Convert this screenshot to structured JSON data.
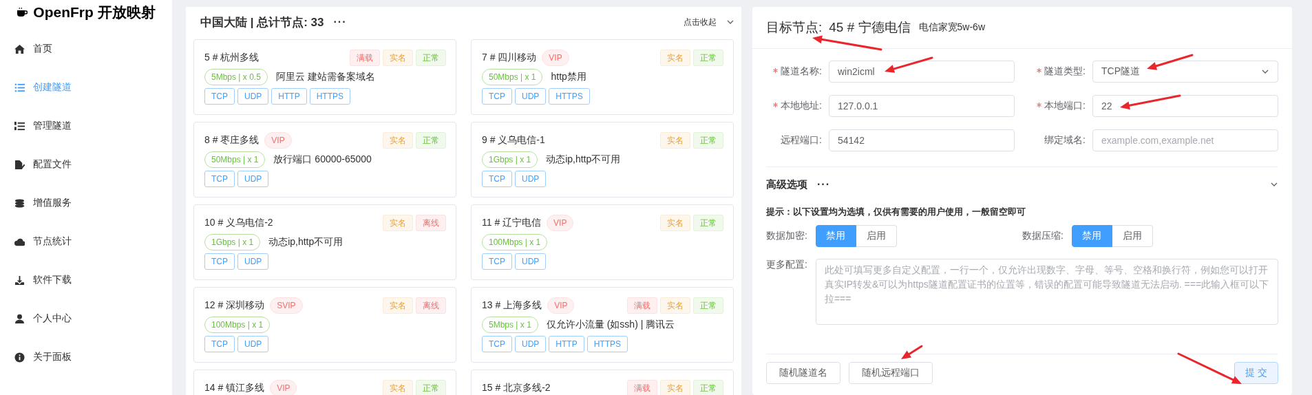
{
  "sidebar": {
    "logo": "OpenFrp 开放映射",
    "items": [
      {
        "label": "首页",
        "selected": false
      },
      {
        "label": "创建隧道",
        "selected": true
      },
      {
        "label": "管理隧道",
        "selected": false
      },
      {
        "label": "配置文件",
        "selected": false
      },
      {
        "label": "增值服务",
        "selected": false
      },
      {
        "label": "节点统计",
        "selected": false
      },
      {
        "label": "软件下载",
        "selected": false
      },
      {
        "label": "个人中心",
        "selected": false
      },
      {
        "label": "关于面板",
        "selected": false
      }
    ]
  },
  "node_panel": {
    "title": "中国大陆 | 总计节点: 33",
    "more": "···",
    "collapse": "点击收起",
    "nodes": [
      {
        "title": "5 # 杭州多线",
        "tags": [
          {
            "label": "满载",
            "kind": "danger"
          },
          {
            "label": "实名",
            "kind": "warning"
          },
          {
            "label": "正常",
            "kind": "success"
          }
        ],
        "speed": "5Mbps | x 0.5",
        "note": "阿里云 建站需备案域名",
        "protocols": [
          "TCP",
          "UDP",
          "HTTP",
          "HTTPS"
        ]
      },
      {
        "title": "7 # 四川移动",
        "level_badge": "VIP",
        "tags": [
          {
            "label": "实名",
            "kind": "warning"
          },
          {
            "label": "正常",
            "kind": "success"
          }
        ],
        "speed": "50Mbps | x 1",
        "note": "http禁用",
        "protocols": [
          "TCP",
          "UDP",
          "HTTPS"
        ]
      },
      {
        "title": "8 # 枣庄多线",
        "level_badge": "VIP",
        "tags": [
          {
            "label": "实名",
            "kind": "warning"
          },
          {
            "label": "正常",
            "kind": "success"
          }
        ],
        "speed": "50Mbps | x 1",
        "note": "放行端口 60000-65000",
        "protocols": [
          "TCP",
          "UDP"
        ]
      },
      {
        "title": "9 # 义乌电信-1",
        "tags": [
          {
            "label": "实名",
            "kind": "warning"
          },
          {
            "label": "正常",
            "kind": "success"
          }
        ],
        "speed": "1Gbps | x 1",
        "note": "动态ip,http不可用",
        "protocols": [
          "TCP",
          "UDP"
        ]
      },
      {
        "title": "10 # 义乌电信-2",
        "tags": [
          {
            "label": "实名",
            "kind": "warning"
          },
          {
            "label": "离线",
            "kind": "danger"
          }
        ],
        "speed": "1Gbps | x 1",
        "note": "动态ip,http不可用",
        "protocols": [
          "TCP",
          "UDP"
        ]
      },
      {
        "title": "11 # 辽宁电信",
        "level_badge": "VIP",
        "tags": [
          {
            "label": "实名",
            "kind": "warning"
          },
          {
            "label": "正常",
            "kind": "success"
          }
        ],
        "speed": "100Mbps | x 1",
        "protocols": [
          "TCP",
          "UDP"
        ]
      },
      {
        "title": "12 # 深圳移动",
        "level_badge": "SVIP",
        "tags": [
          {
            "label": "实名",
            "kind": "warning"
          },
          {
            "label": "离线",
            "kind": "danger"
          }
        ],
        "speed": "100Mbps | x 1",
        "protocols": [
          "TCP",
          "UDP"
        ]
      },
      {
        "title": "13 # 上海多线",
        "level_badge": "VIP",
        "tags": [
          {
            "label": "满载",
            "kind": "danger"
          },
          {
            "label": "实名",
            "kind": "warning"
          },
          {
            "label": "正常",
            "kind": "success"
          }
        ],
        "speed": "5Mbps | x 1",
        "note": "仅允许小流量 (如ssh) | 腾讯云",
        "protocols": [
          "TCP",
          "UDP",
          "HTTP",
          "HTTPS"
        ]
      },
      {
        "title": "14 # 镇江多线",
        "level_badge": "VIP",
        "tags": [
          {
            "label": "实名",
            "kind": "warning"
          },
          {
            "label": "正常",
            "kind": "success"
          }
        ]
      },
      {
        "title": "15 # 北京多线-2",
        "tags": [
          {
            "label": "满载",
            "kind": "danger"
          },
          {
            "label": "实名",
            "kind": "warning"
          },
          {
            "label": "正常",
            "kind": "success"
          }
        ]
      }
    ]
  },
  "form": {
    "target_label": "目标节点:",
    "target": "45 # 宁德电信",
    "target_note": "电信家宽5w-6w",
    "fields": [
      {
        "label": "隧道名称:",
        "required": true,
        "kind": "input",
        "value": "win2icml"
      },
      {
        "label": "隧道类型:",
        "required": true,
        "kind": "select",
        "value": "TCP隧道"
      },
      {
        "label": "本地地址:",
        "required": true,
        "kind": "input",
        "value": "127.0.0.1"
      },
      {
        "label": "本地端口:",
        "required": true,
        "kind": "input",
        "value": "22"
      },
      {
        "label": "远程端口:",
        "required": false,
        "kind": "input",
        "value": "54142"
      },
      {
        "label": "绑定域名:",
        "required": false,
        "kind": "input",
        "placeholder": "example.com,example.net"
      }
    ],
    "advanced": {
      "title": "高级选项",
      "more": "···",
      "hint": "提示：以下设置均为选填，仅供有需要的用户使用，一般留空即可",
      "toggles": [
        {
          "label": "数据加密:",
          "options": [
            {
              "label": "禁用",
              "selected": true
            },
            {
              "label": "启用",
              "selected": false
            }
          ]
        },
        {
          "label": "数据压缩:",
          "options": [
            {
              "label": "禁用",
              "selected": true
            },
            {
              "label": "启用",
              "selected": false
            }
          ]
        }
      ],
      "config_label": "更多配置:",
      "config_placeholder": "此处可填写更多自定义配置，一行一个，仅允许出现数字、字母、等号、空格和换行符，例如您可以打开真实IP转发&可以为https隧道配置证书的位置等，错误的配置可能导致隧道无法启动. ===此输入框可以下拉==="
    },
    "buttons": [
      "随机隧道名",
      "随机远程端口"
    ],
    "submit": "提 交"
  }
}
